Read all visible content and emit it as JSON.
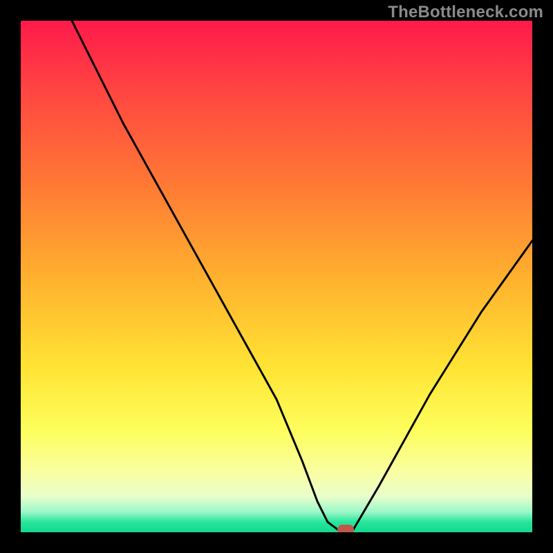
{
  "watermark": "TheBottleneck.com",
  "colors": {
    "background": "#000000",
    "curve": "#000000",
    "marker": "#c1564a",
    "gradient_top": "#ff1a4b",
    "gradient_mid": "#ffe434",
    "gradient_bottom": "#13d98f"
  },
  "chart_data": {
    "type": "line",
    "title": "",
    "xlabel": "",
    "ylabel": "",
    "xlim": [
      0,
      100
    ],
    "ylim": [
      0,
      100
    ],
    "series": [
      {
        "name": "bottleneck",
        "x": [
          10,
          15,
          20,
          25,
          30,
          35,
          40,
          45,
          50,
          55,
          58,
          60,
          62,
          63.5,
          65,
          70,
          75,
          80,
          85,
          90,
          95,
          100
        ],
        "y": [
          100,
          90,
          80,
          71,
          62,
          53,
          44,
          35,
          26,
          14,
          6,
          2,
          0.5,
          0.5,
          0.5,
          9,
          18,
          27,
          35,
          43,
          50,
          57
        ]
      }
    ],
    "marker": {
      "x": 63.5,
      "y": 0.5
    }
  }
}
